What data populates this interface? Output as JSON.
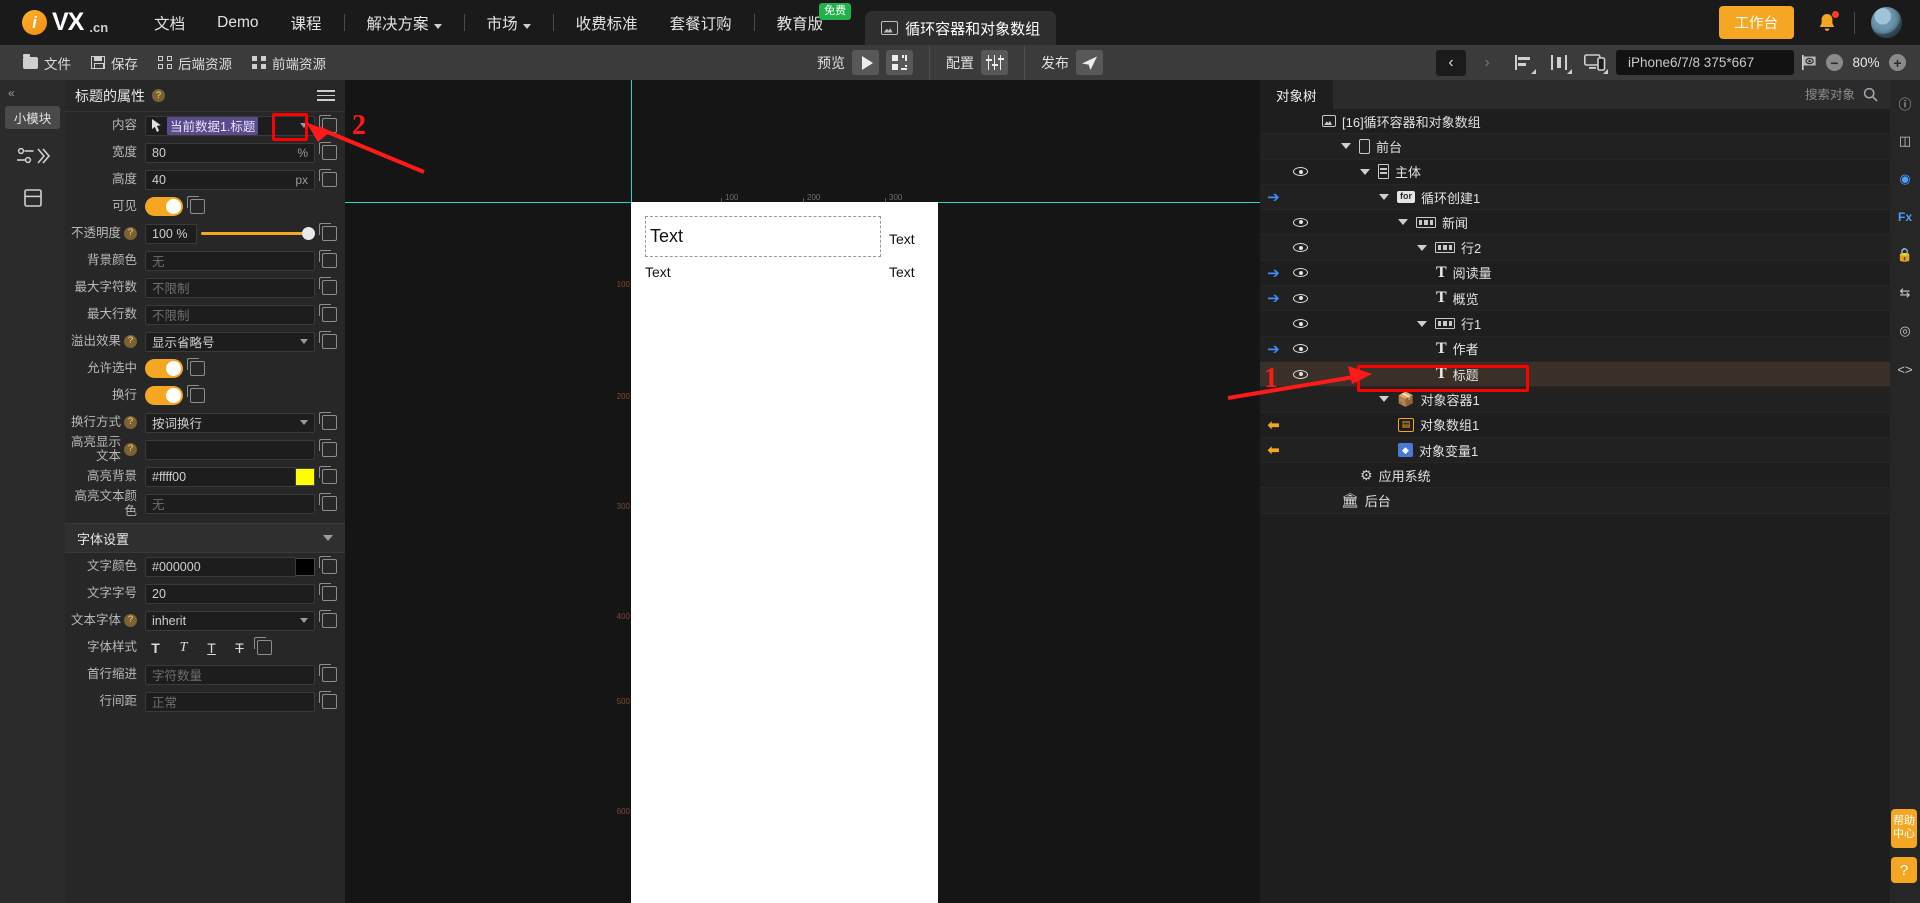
{
  "topnav": {
    "logo_text": "VX",
    "logo_suffix": ".cn",
    "items": [
      {
        "label": "文档",
        "caret": false
      },
      {
        "label": "Demo",
        "caret": false
      },
      {
        "label": "课程",
        "caret": false
      },
      {
        "sep": true
      },
      {
        "label": "解决方案",
        "caret": true
      },
      {
        "sep": true
      },
      {
        "label": "市场",
        "caret": true
      },
      {
        "sep": true
      },
      {
        "label": "收费标准",
        "caret": false
      },
      {
        "label": "套餐订购",
        "caret": false
      },
      {
        "sep": true
      },
      {
        "label": "教育版",
        "caret": false,
        "badge": "免费"
      }
    ],
    "doc_tab": "循环容器和对象数组",
    "workbench_label": "工作台"
  },
  "toolbar": {
    "left": [
      {
        "label": "文件",
        "icon": "folder-icon"
      },
      {
        "label": "保存",
        "icon": "save-icon"
      },
      {
        "label": "后端资源",
        "icon": "backend-resource-icon"
      },
      {
        "label": "前端资源",
        "icon": "frontend-resource-icon"
      }
    ],
    "preview_label": "预览",
    "config_label": "配置",
    "publish_label": "发布",
    "device": "iPhone6/7/8 375*667",
    "zoom": "80%"
  },
  "leftrail": {
    "module_label": "小模块"
  },
  "props": {
    "title": "标题的属性",
    "rows": [
      {
        "label": "内容",
        "value": "当前数据1.标题",
        "type": "binding"
      },
      {
        "label": "宽度",
        "value": "80",
        "unit": "%",
        "type": "text"
      },
      {
        "label": "高度",
        "value": "40",
        "unit": "px",
        "type": "text"
      },
      {
        "label": "可见",
        "value": "",
        "type": "toggle"
      },
      {
        "label": "不透明度",
        "value": "100 %",
        "type": "slider",
        "help": true
      },
      {
        "label": "背景颜色",
        "value": "无",
        "type": "placeholder"
      },
      {
        "label": "最大字符数",
        "value": "不限制",
        "type": "placeholder"
      },
      {
        "label": "最大行数",
        "value": "不限制",
        "type": "placeholder"
      },
      {
        "label": "溢出效果",
        "value": "显示省略号",
        "type": "select",
        "help": true
      },
      {
        "label": "允许选中",
        "value": "",
        "type": "toggle"
      },
      {
        "label": "换行",
        "value": "",
        "type": "toggle"
      },
      {
        "label": "换行方式",
        "value": "按词换行",
        "type": "select",
        "help": true
      },
      {
        "label": "高亮显示文本",
        "value": "",
        "type": "text",
        "help": true,
        "twoline": true
      },
      {
        "label": "高亮背景",
        "value": "#ffff00",
        "type": "color",
        "color": "#ffff00"
      },
      {
        "label": "高亮文本颜色",
        "value": "无",
        "type": "placeholder"
      }
    ],
    "font_section": "字体设置",
    "font_rows": [
      {
        "label": "文字颜色",
        "value": "#000000",
        "type": "color",
        "color": "#000000"
      },
      {
        "label": "文字字号",
        "value": "20",
        "type": "text"
      },
      {
        "label": "文本字体",
        "value": "inherit",
        "type": "select",
        "help": true
      },
      {
        "label": "字体样式",
        "value": "",
        "type": "fontstyle"
      },
      {
        "label": "首行缩进",
        "value": "字符数量",
        "type": "placeholder"
      },
      {
        "label": "行间距",
        "value": "正常",
        "type": "placeholder"
      }
    ],
    "fontstyle_buttons": [
      "T",
      "T",
      "T",
      "T"
    ]
  },
  "canvas": {
    "ruler_labels": [
      "100",
      "200",
      "300"
    ],
    "vruler_labels": [
      "100",
      "200",
      "300",
      "400",
      "500",
      "600"
    ],
    "texts": [
      {
        "label": "Text",
        "big": true
      },
      {
        "label": "Text"
      },
      {
        "label": "Text"
      },
      {
        "label": "Text"
      }
    ]
  },
  "tree": {
    "tab": "对象树",
    "search_placeholder": "搜索对象",
    "rows": [
      {
        "indent": 0,
        "label": "[16]循环容器和对象数组",
        "icon": "page-icon",
        "eye": false,
        "goto": false,
        "arrow": false
      },
      {
        "indent": 1,
        "label": "前台",
        "icon": "phone-icon",
        "eye": false,
        "goto": false,
        "arrow": true
      },
      {
        "indent": 2,
        "label": "主体",
        "icon": "body-icon",
        "eye": true,
        "goto": false,
        "arrow": true
      },
      {
        "indent": 3,
        "label": "循环创建1",
        "icon": "for-icon",
        "eye": false,
        "goto": true,
        "arrow": true
      },
      {
        "indent": 4,
        "label": "新闻",
        "icon": "row-icon",
        "eye": true,
        "goto": false,
        "arrow": true
      },
      {
        "indent": 5,
        "label": "行2",
        "icon": "row-icon",
        "eye": true,
        "goto": false,
        "arrow": true
      },
      {
        "indent": 6,
        "label": "阅读量",
        "icon": "text-icon",
        "eye": true,
        "goto": true,
        "arrow": false
      },
      {
        "indent": 6,
        "label": "概览",
        "icon": "text-icon",
        "eye": true,
        "goto": true,
        "arrow": false
      },
      {
        "indent": 5,
        "label": "行1",
        "icon": "row-icon",
        "eye": true,
        "goto": false,
        "arrow": true
      },
      {
        "indent": 6,
        "label": "作者",
        "icon": "text-icon",
        "eye": true,
        "goto": true,
        "arrow": false
      },
      {
        "indent": 6,
        "label": "标题",
        "icon": "text-icon",
        "eye": true,
        "goto": false,
        "arrow": false,
        "selected": true
      },
      {
        "indent": 3,
        "label": "对象容器1",
        "icon": "cube-icon",
        "eye": false,
        "goto": false,
        "arrow": true
      },
      {
        "indent": 4,
        "label": "对象数组1",
        "icon": "array-icon",
        "eye": false,
        "goto": false,
        "back": true,
        "arrow": false
      },
      {
        "indent": 4,
        "label": "对象变量1",
        "icon": "var-icon",
        "eye": false,
        "goto": false,
        "back": true,
        "arrow": false
      },
      {
        "indent": 2,
        "label": "应用系统",
        "icon": "gear-icon",
        "eye": false,
        "goto": false,
        "arrow": false
      },
      {
        "indent": 1,
        "label": "后台",
        "icon": "backend-icon",
        "eye": false,
        "goto": false,
        "arrow": false
      }
    ]
  },
  "rrail": {
    "help_text": "帮助中心"
  },
  "annotations": {
    "marker_1": "1",
    "marker_2": "2"
  },
  "colors": {
    "accent": "#f5a623",
    "highlight_bg": "#ffff00",
    "text_color": "#000000",
    "annotation": "#ff0000",
    "guide": "#2ad6c6",
    "binding": "#5b4b8a"
  }
}
